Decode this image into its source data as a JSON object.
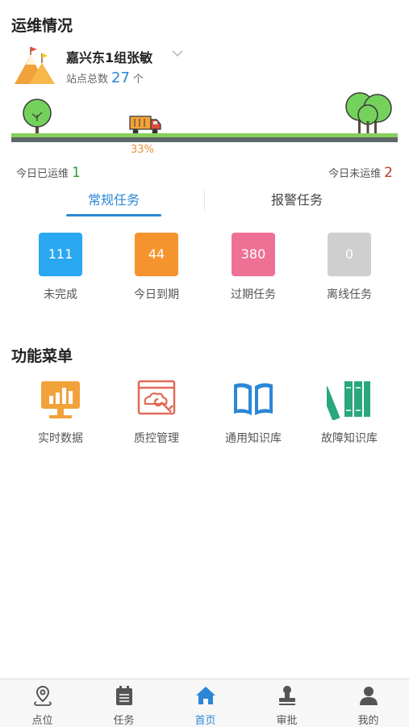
{
  "ops": {
    "title": "运维情况",
    "group_name": "嘉兴东1组张敏",
    "site_label": "站点总数",
    "site_count": "27",
    "site_unit": "个",
    "progress_text": "33%",
    "progress_value": 0.33,
    "done_today_label": "今日已运维",
    "done_today_count": "1",
    "not_done_label": "今日未运维",
    "not_done_count": "2"
  },
  "tabs": [
    {
      "label": "常规任务",
      "active": true
    },
    {
      "label": "报警任务",
      "active": false
    }
  ],
  "tasks": [
    {
      "value": "111",
      "label": "未完成",
      "color": "#2aa8f2"
    },
    {
      "value": "44",
      "label": "今日到期",
      "color": "#f5942f"
    },
    {
      "value": "380",
      "label": "过期任务",
      "color": "#ee7195"
    },
    {
      "value": "0",
      "label": "离线任务",
      "color": "#cfcfcf"
    }
  ],
  "menu": {
    "title": "功能菜单",
    "items": [
      {
        "label": "实时数据",
        "icon": "monitor-chart-icon"
      },
      {
        "label": "质控管理",
        "icon": "quality-control-icon"
      },
      {
        "label": "通用知识库",
        "icon": "open-book-icon"
      },
      {
        "label": "故障知识库",
        "icon": "books-icon"
      }
    ]
  },
  "nav": [
    {
      "label": "点位",
      "icon": "location-pin-icon",
      "active": false
    },
    {
      "label": "任务",
      "icon": "calendar-icon",
      "active": false
    },
    {
      "label": "首页",
      "icon": "home-icon",
      "active": true
    },
    {
      "label": "审批",
      "icon": "stamp-icon",
      "active": false
    },
    {
      "label": "我的",
      "icon": "user-icon",
      "active": false
    }
  ],
  "colors": {
    "accent": "#2c87d6",
    "progress": "#e8913a",
    "done_green": "#2e9a3d",
    "not_done_red": "#c0392b"
  }
}
